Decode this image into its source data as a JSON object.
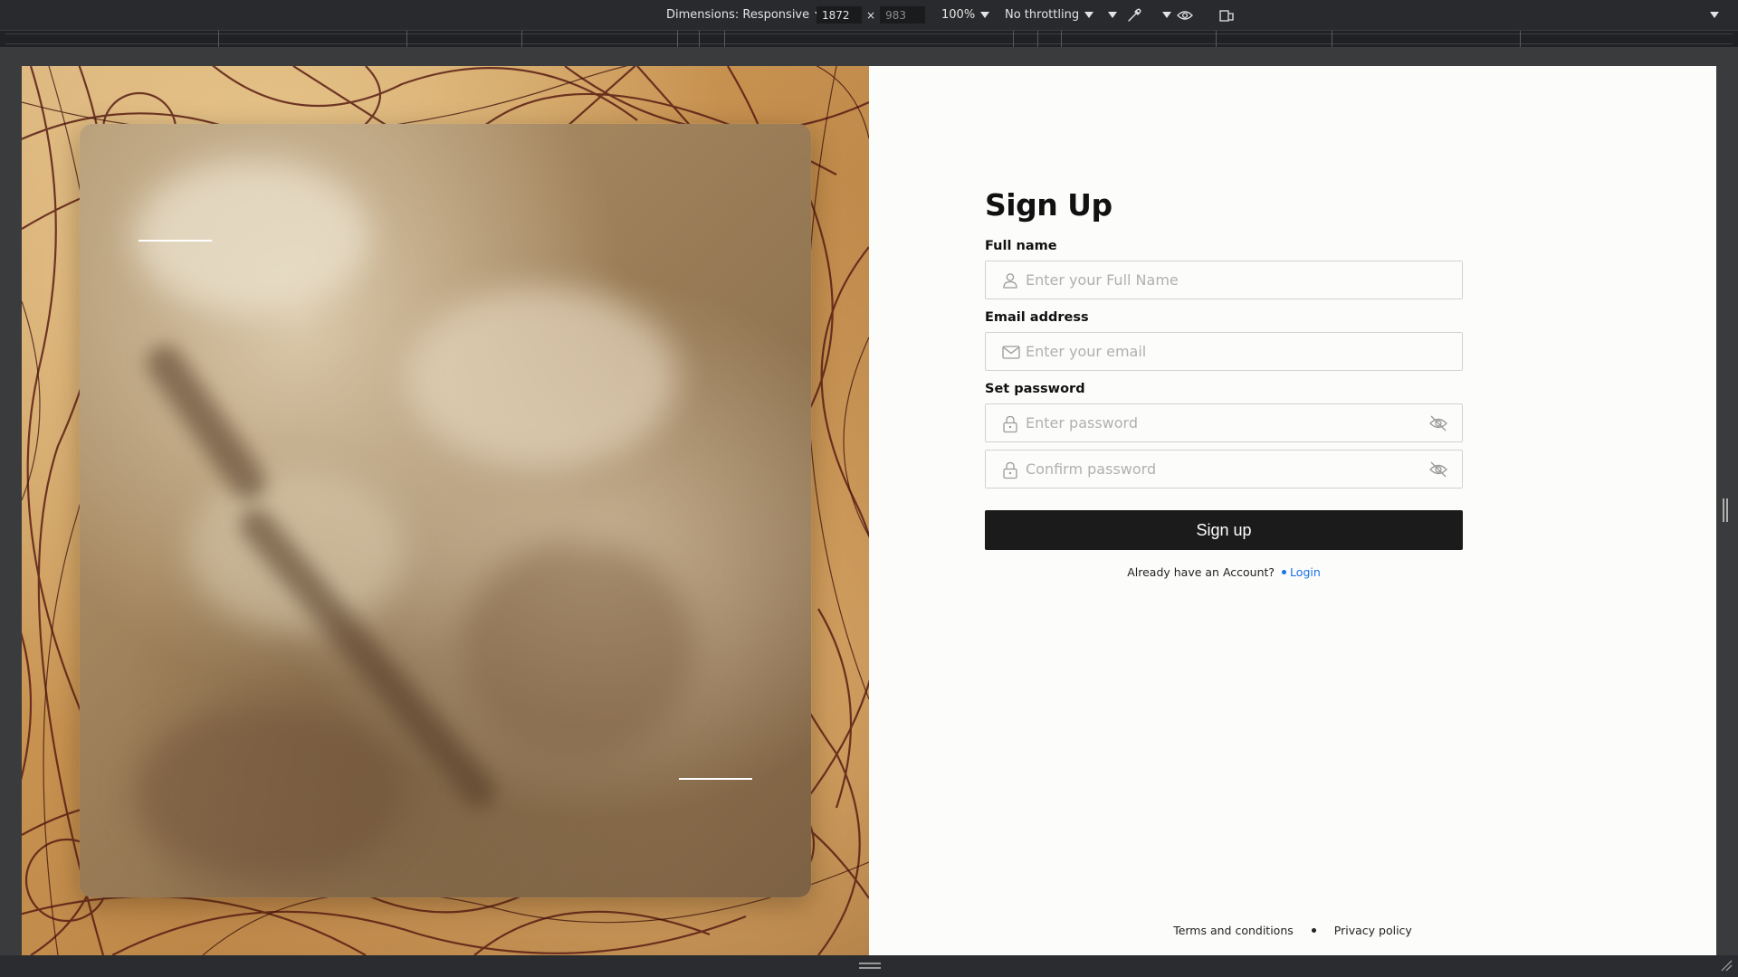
{
  "devtools": {
    "dimensions_label": "Dimensions: Responsive",
    "width_value": "1872",
    "height_value": "983",
    "times_symbol": "×",
    "zoom_label": "100%",
    "throttling_label": "No throttling"
  },
  "signup": {
    "title": "Sign Up",
    "full_name": {
      "label": "Full name",
      "placeholder": "Enter your Full Name"
    },
    "email": {
      "label": "Email address",
      "placeholder": "Enter your email"
    },
    "password": {
      "label": "Set password",
      "placeholder": "Enter password",
      "confirm_placeholder": "Confirm password"
    },
    "submit_label": "Sign up",
    "already_text": "Already have an Account?",
    "login_label": "Login"
  },
  "footer": {
    "terms_label": "Terms and conditions",
    "privacy_label": "Privacy policy"
  },
  "colors": {
    "button_bg": "#1b1b1b",
    "link": "#1a73e8",
    "input_border": "#d2d2d2",
    "devtools_bg": "#292a2d"
  },
  "icons": [
    "user-icon",
    "mail-icon",
    "lock-icon",
    "eye-off-icon",
    "eyedropper-icon",
    "eye-icon",
    "rotate-device-icon"
  ]
}
